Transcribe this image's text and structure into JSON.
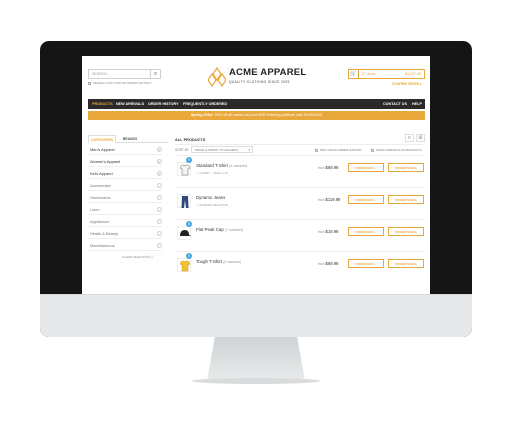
{
  "search": {
    "placeholder": "SEARCH...",
    "only_history_label": "SEARCH ONLY WITHIN ORDER HISTORY"
  },
  "brand": {
    "name": "ACME APPAREL",
    "tagline": "QUALITY CLOTHING SINCE 2009"
  },
  "cart": {
    "items": "27 items",
    "total": "$4,347.95",
    "checkout": "CONFIRM ORDER ▸"
  },
  "nav": {
    "products": "PRODUCTS",
    "new_arrivals": "NEW ARRIVALS",
    "order_history": "ORDER HISTORY",
    "frequently_ordered": "FREQUENTLY ORDERED",
    "contact": "CONTACT US",
    "help": "HELP"
  },
  "promo": {
    "bold": "Spring Offer:",
    "text": " 20% off all orders via your B2B Ordering platform until 21/06/2015"
  },
  "sidebar": {
    "tab_categories": "CATEGORIES",
    "tab_brands": "BRANDS",
    "categories": [
      {
        "label": "Men's Apparel",
        "checked": true
      },
      {
        "label": "Women's Apparel",
        "checked": true
      },
      {
        "label": "Kid's Apparel",
        "checked": true
      },
      {
        "label": "Accessories",
        "checked": false
      },
      {
        "label": "Homewares",
        "checked": false
      },
      {
        "label": "Linen",
        "checked": false
      },
      {
        "label": "Appliances",
        "checked": false
      },
      {
        "label": "Health & Beauty",
        "checked": false
      },
      {
        "label": "Miscellaneous",
        "checked": false
      }
    ],
    "clear": "CLEAR SELECTION ⓧ"
  },
  "products_header": {
    "title": "ALL PRODUCTS",
    "sort_by": "SORT BY",
    "sort_value": "PRICE (LOWEST TO HIGHEST)",
    "opt_history": "ONLY FROM ORDER HISTORY",
    "opt_variants": "SHOW VARIANTS AS PRODUCTS"
  },
  "products": [
    {
      "name": "Standard T-Shirt",
      "variants": "(6 variants)",
      "sub": "▢ T-SHIRT   ▢ SMALL (+3)",
      "from": "from",
      "price": "$69.99",
      "badge": "9",
      "icon": "t-shirt-icon",
      "more": "MORE INFO ›",
      "order": "ORDER NOW ▸"
    },
    {
      "name": "Dynamo Jeans",
      "variants": "",
      "sub": "▢ WOMEN'S SELECTION",
      "from": "from",
      "price": "$119.99",
      "badge": "",
      "icon": "jeans-icon",
      "more": "MORE INFO ›",
      "order": "ORDER NOW ▸"
    },
    {
      "name": "Flat Peak Cap",
      "variants": "(7 variants)",
      "sub": "",
      "from": "from",
      "price": "$19.99",
      "badge": "6",
      "icon": "cap-icon",
      "more": "MORE INFO ›",
      "order": "ORDER NOW ▸"
    },
    {
      "name": "Tough T-Shirt",
      "variants": "(6 variants)",
      "sub": "",
      "from": "from",
      "price": "$69.99",
      "badge": "6",
      "icon": "yellow-t-shirt-icon",
      "more": "MORE INFO ›",
      "order": "ORDER NOW ▸"
    }
  ],
  "colors": {
    "accent": "#e8a83c",
    "nav_bg": "#2a2a2a",
    "check": "#4aa3df"
  }
}
